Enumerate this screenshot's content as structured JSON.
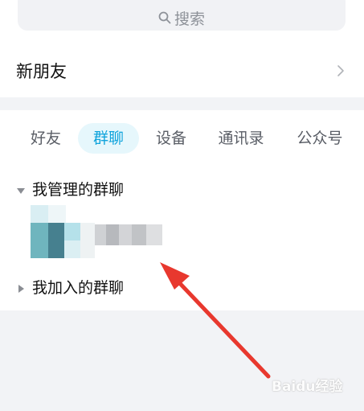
{
  "search": {
    "label": "搜索",
    "icon": "search-icon"
  },
  "new_friend": {
    "label": "新朋友",
    "icon": "chevron-right-icon"
  },
  "tabs": [
    {
      "label": "好友",
      "active": false
    },
    {
      "label": "群聊",
      "active": true
    },
    {
      "label": "设备",
      "active": false
    },
    {
      "label": "通讯录",
      "active": false
    },
    {
      "label": "公众号",
      "active": false
    }
  ],
  "groups": [
    {
      "title": "我管理的群聊",
      "expanded": true
    },
    {
      "title": "我加入的群聊",
      "expanded": false
    }
  ],
  "colors": {
    "accent": "#10a4dc",
    "tab_active_bg": "#e6f7fc",
    "annotation_arrow": "#e8382e",
    "page_bg": "#f2f3f6"
  },
  "watermark": "Baidu经验"
}
